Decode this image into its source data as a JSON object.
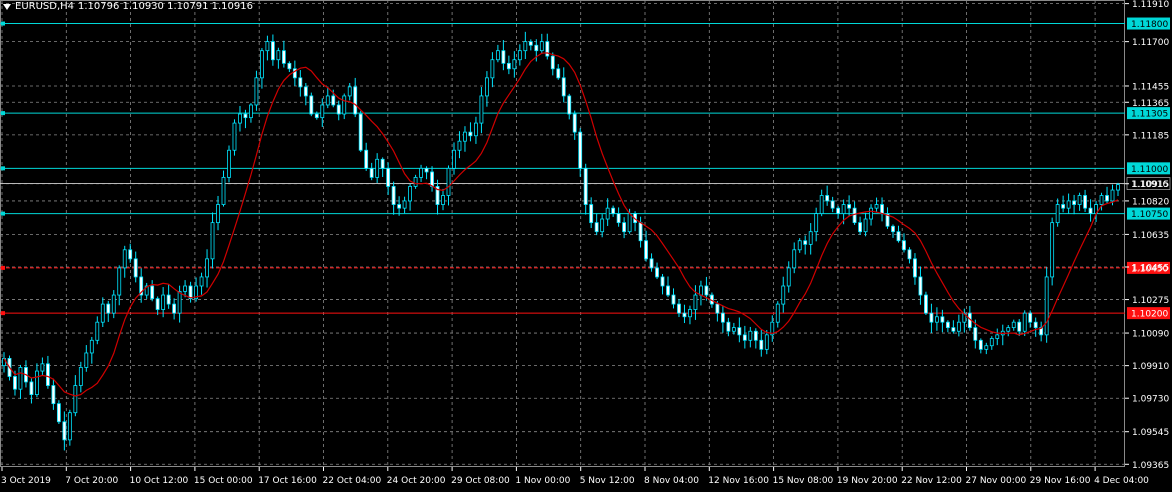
{
  "header": {
    "symbol": "EURUSD,H4",
    "ohlc": "1.10796 1.10930 1.10791 1.10916"
  },
  "colors": {
    "background": "#000000",
    "grid": "#8a8a8a",
    "candle": "#00e5ff",
    "ma": "#d00000",
    "cyan_level": "#00d8d8",
    "red_level": "#ff1010",
    "current_price": "#d0d0d0",
    "axis_text": "#ffffff"
  },
  "chart_data": {
    "type": "line",
    "symbol": "EURUSD",
    "timeframe": "H4",
    "price_ticks": [
      "1.11910",
      "1.11700",
      "1.11455",
      "1.11365",
      "1.11185",
      "1.10915",
      "1.10820",
      "1.10635",
      "1.10455",
      "1.10275",
      "1.10090",
      "1.09910",
      "1.09730",
      "1.09545",
      "1.09365"
    ],
    "time_ticks": [
      "3 Oct 2019",
      "7 Oct 20:00",
      "10 Oct 12:00",
      "15 Oct 00:00",
      "17 Oct 16:00",
      "22 Oct 04:00",
      "24 Oct 20:00",
      "29 Oct 08:00",
      "1 Nov 00:00",
      "5 Nov 12:00",
      "8 Nov 04:00",
      "12 Nov 16:00",
      "15 Nov 08:00",
      "19 Nov 20:00",
      "22 Nov 12:00",
      "27 Nov 00:00",
      "29 Nov 16:00",
      "4 Dec 04:00"
    ],
    "ylim": [
      1.0935,
      1.1193
    ],
    "current_price": {
      "value": 1.10916,
      "label": "1.10916"
    },
    "levels": [
      {
        "value": 1.118,
        "label": "1.11800",
        "color": "cyan"
      },
      {
        "value": 1.11305,
        "label": "1.11305",
        "color": "cyan"
      },
      {
        "value": 1.11,
        "label": "1.11000",
        "color": "cyan"
      },
      {
        "value": 1.1075,
        "label": "1.10750",
        "color": "cyan"
      },
      {
        "value": 1.1045,
        "label": "1.10450",
        "color": "red",
        "dashed": true
      },
      {
        "value": 1.102,
        "label": "1.10200",
        "color": "red"
      }
    ],
    "series": [
      {
        "kind": "close",
        "values": [
          1.0995,
          1.0985,
          1.0978,
          1.099,
          1.0982,
          1.0975,
          1.0988,
          1.0992,
          1.098,
          1.097,
          1.096,
          1.095,
          1.0965,
          1.098,
          1.099,
          1.0998,
          1.1005,
          1.1015,
          1.1025,
          1.102,
          1.103,
          1.1045,
          1.1055,
          1.105,
          1.104,
          1.103,
          1.1035,
          1.1028,
          1.1022,
          1.103,
          1.1025,
          1.102,
          1.1032,
          1.1035,
          1.1028,
          1.1035,
          1.104,
          1.105,
          1.107,
          1.108,
          1.1095,
          1.111,
          1.1125,
          1.113,
          1.1128,
          1.1135,
          1.115,
          1.1165,
          1.117,
          1.116,
          1.1165,
          1.1158,
          1.1155,
          1.115,
          1.1145,
          1.114,
          1.113,
          1.1128,
          1.1135,
          1.114,
          1.1135,
          1.113,
          1.114,
          1.1145,
          1.113,
          1.111,
          1.11,
          1.1095,
          1.1105,
          1.11,
          1.109,
          1.108,
          1.1078,
          1.1082,
          1.109,
          1.1095,
          1.11,
          1.1098,
          1.109,
          1.108,
          1.1085,
          1.11,
          1.111,
          1.1115,
          1.112,
          1.1118,
          1.1125,
          1.114,
          1.115,
          1.116,
          1.1165,
          1.1158,
          1.1155,
          1.116,
          1.1165,
          1.117,
          1.1168,
          1.1165,
          1.117,
          1.1162,
          1.1155,
          1.115,
          1.114,
          1.113,
          1.112,
          1.11,
          1.108,
          1.107,
          1.1065,
          1.1072,
          1.1078,
          1.1075,
          1.107,
          1.1065,
          1.1075,
          1.107,
          1.106,
          1.105,
          1.1045,
          1.104,
          1.1035,
          1.103,
          1.1025,
          1.102,
          1.1018,
          1.1022,
          1.103,
          1.1035,
          1.103,
          1.1025,
          1.102,
          1.1015,
          1.101,
          1.1012,
          1.1008,
          1.1005,
          1.101,
          1.1005,
          1.1,
          1.1008,
          1.1015,
          1.1025,
          1.1035,
          1.1045,
          1.1055,
          1.106,
          1.1058,
          1.1065,
          1.1075,
          1.1085,
          1.1082,
          1.1078,
          1.1075,
          1.108,
          1.1078,
          1.107,
          1.1065,
          1.1072,
          1.1078,
          1.108,
          1.1075,
          1.1068,
          1.1065,
          1.106,
          1.1055,
          1.105,
          1.104,
          1.103,
          1.102,
          1.1015,
          1.1018,
          1.1015,
          1.1012,
          1.101,
          1.1015,
          1.102,
          1.1012,
          1.1005,
          1.1,
          1.1002,
          1.1006,
          1.1008,
          1.101,
          1.1012,
          1.1015,
          1.101,
          1.102,
          1.1015,
          1.1012,
          1.1008,
          1.104,
          1.107,
          1.108,
          1.1078,
          1.1082,
          1.108,
          1.1085,
          1.1078,
          1.1075,
          1.108,
          1.1085,
          1.1082,
          1.1088,
          1.1091
        ]
      }
    ]
  }
}
